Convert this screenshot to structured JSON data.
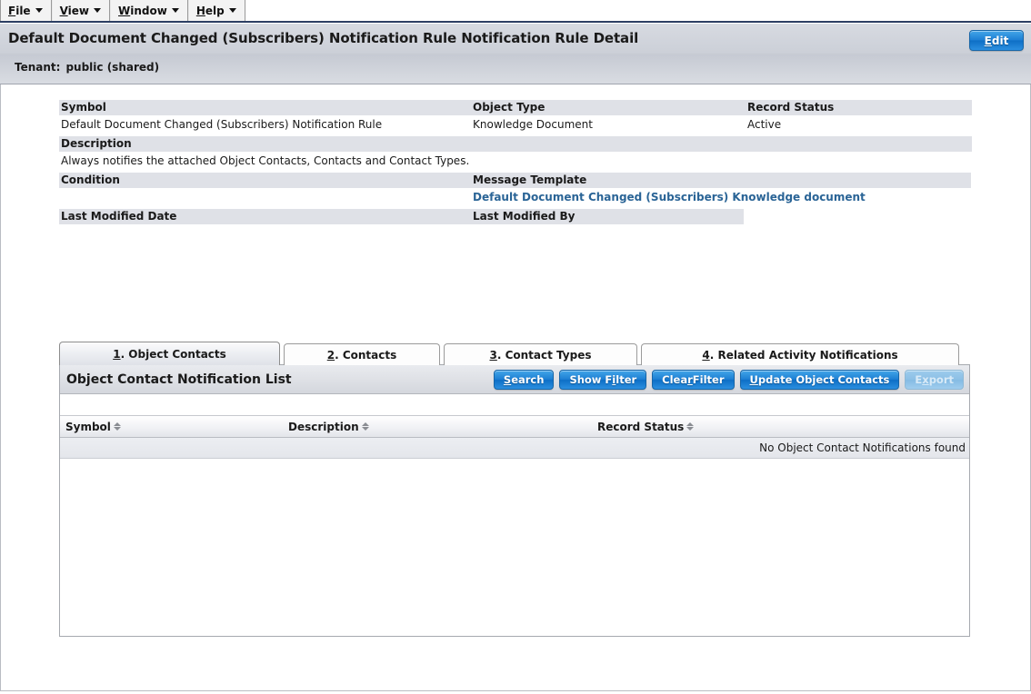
{
  "menubar": {
    "items": [
      {
        "name": "file",
        "mnemonic": "F",
        "rest": "ile"
      },
      {
        "name": "view",
        "mnemonic": "V",
        "rest": "iew"
      },
      {
        "name": "window",
        "mnemonic": "W",
        "rest": "indow"
      },
      {
        "name": "help",
        "mnemonic": "H",
        "rest": "elp"
      }
    ]
  },
  "header": {
    "title": "Default Document Changed (Subscribers) Notification Rule Notification Rule Detail",
    "tenant_label": "Tenant:",
    "tenant_value": "public (shared)",
    "edit_button": {
      "mnemonic": "E",
      "rest": "dit"
    }
  },
  "detail": {
    "symbol": {
      "label": "Symbol",
      "value": "Default Document Changed (Subscribers) Notification Rule"
    },
    "object_type": {
      "label": "Object Type",
      "value": "Knowledge Document"
    },
    "record_status": {
      "label": "Record Status",
      "value": "Active"
    },
    "description": {
      "label": "Description",
      "value": "Always notifies the attached Object Contacts, Contacts and Contact Types."
    },
    "condition": {
      "label": "Condition",
      "value": ""
    },
    "message_template": {
      "label": "Message Template",
      "value": "Default Document Changed (Subscribers) Knowledge document"
    },
    "last_modified_date": {
      "label": "Last Modified Date",
      "value": ""
    },
    "last_modified_by": {
      "label": "Last Modified By",
      "value": ""
    }
  },
  "tabs": [
    {
      "name": "object-contacts",
      "mnemonic": "1",
      "rest": ". Object Contacts",
      "active": true
    },
    {
      "name": "contacts",
      "mnemonic": "2",
      "rest": ". Contacts",
      "active": false
    },
    {
      "name": "contact-types",
      "mnemonic": "3",
      "rest": ". Contact Types",
      "active": false
    },
    {
      "name": "related-activity-notifications",
      "mnemonic": "4",
      "rest": ". Related Activity Notifications",
      "active": false
    }
  ],
  "list_panel": {
    "title": "Object Contact Notification List",
    "buttons": [
      {
        "name": "search",
        "pre": "",
        "mnemonic": "S",
        "post": "earch",
        "disabled": false
      },
      {
        "name": "show-filter",
        "pre": "Show F",
        "mnemonic": "i",
        "post": "lter",
        "disabled": false
      },
      {
        "name": "clear-filter",
        "pre": "Clea",
        "mnemonic": "r",
        "post": " Filter",
        "disabled": false
      },
      {
        "name": "update-object-contacts",
        "pre": "",
        "mnemonic": "U",
        "post": "pdate Object Contacts",
        "disabled": false
      },
      {
        "name": "export",
        "pre": "E",
        "mnemonic": "x",
        "post": "port",
        "disabled": true
      }
    ],
    "columns": [
      {
        "name": "symbol",
        "label": "Symbol"
      },
      {
        "name": "description",
        "label": "Description"
      },
      {
        "name": "record-status",
        "label": "Record Status"
      }
    ],
    "empty_message": "No Object Contact Notifications found",
    "rows": []
  },
  "colors": {
    "accent_blue": "#1d7fd4",
    "link_blue": "#2a6496",
    "label_bg": "#dfe1e7",
    "header_band": "#ccd0d8",
    "menu_underline": "#2c3e63"
  }
}
